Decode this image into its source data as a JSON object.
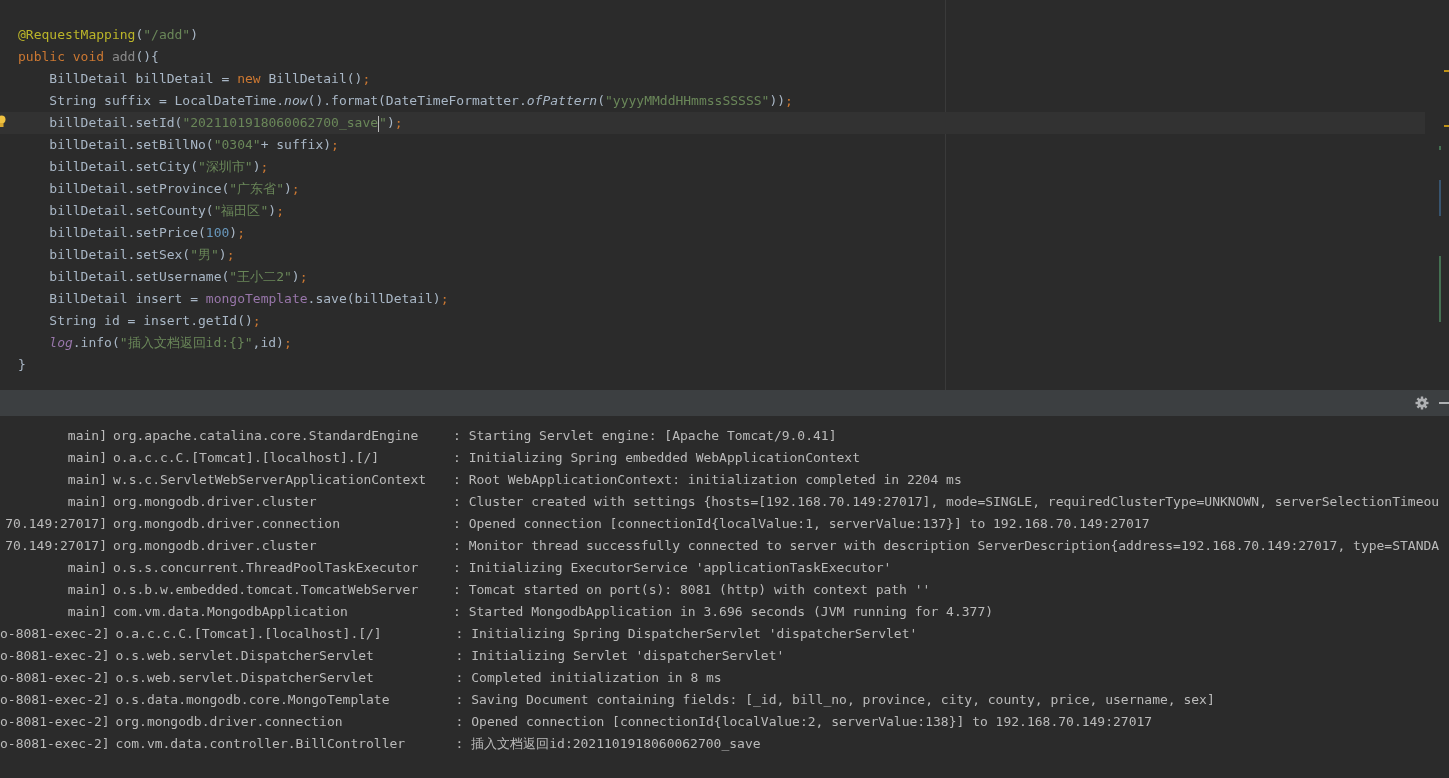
{
  "editor": {
    "lines": [
      {
        "current": false,
        "bulb": false,
        "tokens": [
          {
            "kind": "annotation",
            "text": "@RequestMapping"
          },
          {
            "kind": "plain",
            "text": "("
          },
          {
            "kind": "string",
            "text": "\"/add\""
          },
          {
            "kind": "plain",
            "text": ")"
          }
        ]
      },
      {
        "current": false,
        "bulb": false,
        "tokens": [
          {
            "kind": "keyword",
            "text": "public void "
          },
          {
            "kind": "unused",
            "text": "add"
          },
          {
            "kind": "plain",
            "text": "(){"
          }
        ]
      },
      {
        "current": false,
        "bulb": false,
        "tokens": [
          {
            "kind": "plain",
            "text": "    BillDetail billDetail = "
          },
          {
            "kind": "keyword",
            "text": "new "
          },
          {
            "kind": "plain",
            "text": "BillDetail()"
          },
          {
            "kind": "keyword",
            "text": ";"
          }
        ]
      },
      {
        "current": false,
        "bulb": false,
        "tokens": [
          {
            "kind": "plain",
            "text": "    String suffix = LocalDateTime."
          },
          {
            "kind": "italic",
            "text": "now"
          },
          {
            "kind": "plain",
            "text": "().format(DateTimeFormatter."
          },
          {
            "kind": "italic",
            "text": "ofPattern"
          },
          {
            "kind": "plain",
            "text": "("
          },
          {
            "kind": "string",
            "text": "\"yyyyMMddHHmmssSSSSS\""
          },
          {
            "kind": "plain",
            "text": "))"
          },
          {
            "kind": "keyword",
            "text": ";"
          }
        ]
      },
      {
        "current": true,
        "bulb": true,
        "tokens": [
          {
            "kind": "plain",
            "text": "    billDetail.setId("
          },
          {
            "kind": "string",
            "text": "\"2021101918060062700_save",
            "caret": true
          },
          {
            "kind": "string",
            "text": "\""
          },
          {
            "kind": "plain",
            "text": ")"
          },
          {
            "kind": "keyword",
            "text": ";"
          }
        ]
      },
      {
        "current": false,
        "bulb": false,
        "tokens": [
          {
            "kind": "plain",
            "text": "    billDetail.setBillNo("
          },
          {
            "kind": "string",
            "text": "\"0304\""
          },
          {
            "kind": "plain",
            "text": "+ suffix)"
          },
          {
            "kind": "keyword",
            "text": ";"
          }
        ]
      },
      {
        "current": false,
        "bulb": false,
        "tokens": [
          {
            "kind": "plain",
            "text": "    billDetail.setCity("
          },
          {
            "kind": "string",
            "text": "\"深圳市\""
          },
          {
            "kind": "plain",
            "text": ")"
          },
          {
            "kind": "keyword",
            "text": ";"
          }
        ]
      },
      {
        "current": false,
        "bulb": false,
        "tokens": [
          {
            "kind": "plain",
            "text": "    billDetail.setProvince("
          },
          {
            "kind": "string",
            "text": "\"广东省\""
          },
          {
            "kind": "plain",
            "text": ")"
          },
          {
            "kind": "keyword",
            "text": ";"
          }
        ]
      },
      {
        "current": false,
        "bulb": false,
        "tokens": [
          {
            "kind": "plain",
            "text": "    billDetail.setCounty("
          },
          {
            "kind": "string",
            "text": "\"福田区\""
          },
          {
            "kind": "plain",
            "text": ")"
          },
          {
            "kind": "keyword",
            "text": ";"
          }
        ]
      },
      {
        "current": false,
        "bulb": false,
        "tokens": [
          {
            "kind": "plain",
            "text": "    billDetail.setPrice("
          },
          {
            "kind": "number",
            "text": "100"
          },
          {
            "kind": "plain",
            "text": ")"
          },
          {
            "kind": "keyword",
            "text": ";"
          }
        ]
      },
      {
        "current": false,
        "bulb": false,
        "tokens": [
          {
            "kind": "plain",
            "text": "    billDetail.setSex("
          },
          {
            "kind": "string",
            "text": "\"男\""
          },
          {
            "kind": "plain",
            "text": ")"
          },
          {
            "kind": "keyword",
            "text": ";"
          }
        ]
      },
      {
        "current": false,
        "bulb": false,
        "tokens": [
          {
            "kind": "plain",
            "text": "    billDetail.setUsername("
          },
          {
            "kind": "string",
            "text": "\"王小二2\""
          },
          {
            "kind": "plain",
            "text": ")"
          },
          {
            "kind": "keyword",
            "text": ";"
          }
        ]
      },
      {
        "current": false,
        "bulb": false,
        "tokens": [
          {
            "kind": "plain",
            "text": "    BillDetail insert = "
          },
          {
            "kind": "field",
            "text": "mongoTemplate"
          },
          {
            "kind": "plain",
            "text": ".save(billDetail)"
          },
          {
            "kind": "keyword",
            "text": ";"
          }
        ]
      },
      {
        "current": false,
        "bulb": false,
        "tokens": [
          {
            "kind": "plain",
            "text": "    String id = insert.getId()"
          },
          {
            "kind": "keyword",
            "text": ";"
          }
        ]
      },
      {
        "current": false,
        "bulb": false,
        "tokens": [
          {
            "kind": "italic_field",
            "text": "    log"
          },
          {
            "kind": "plain",
            "text": ".info("
          },
          {
            "kind": "string",
            "text": "\"插入文档返回id:{}\""
          },
          {
            "kind": "plain",
            "text": ",id)"
          },
          {
            "kind": "keyword",
            "text": ";"
          }
        ]
      },
      {
        "current": false,
        "bulb": false,
        "tokens": [
          {
            "kind": "plain",
            "text": "}"
          }
        ]
      }
    ]
  },
  "console": {
    "rows": [
      {
        "thread": "main]",
        "logger": "org.apache.catalina.core.StandardEngine",
        "message": ": Starting Servlet engine: [Apache Tomcat/9.0.41]"
      },
      {
        "thread": "main]",
        "logger": "o.a.c.c.C.[Tomcat].[localhost].[/]",
        "message": ": Initializing Spring embedded WebApplicationContext"
      },
      {
        "thread": "main]",
        "logger": "w.s.c.ServletWebServerApplicationContext",
        "message": ": Root WebApplicationContext: initialization completed in 2204 ms"
      },
      {
        "thread": "main]",
        "logger": "org.mongodb.driver.cluster",
        "message": ": Cluster created with settings {hosts=[192.168.70.149:27017], mode=SINGLE, requiredClusterType=UNKNOWN, serverSelectionTimeou"
      },
      {
        "thread": "70.149:27017]",
        "logger": "org.mongodb.driver.connection",
        "message": ": Opened connection [connectionId{localValue:1, serverValue:137}] to 192.168.70.149:27017"
      },
      {
        "thread": "70.149:27017]",
        "logger": "org.mongodb.driver.cluster",
        "message": ": Monitor thread successfully connected to server with description ServerDescription{address=192.168.70.149:27017, type=STANDA"
      },
      {
        "thread": "main]",
        "logger": "o.s.s.concurrent.ThreadPoolTaskExecutor",
        "message": ": Initializing ExecutorService 'applicationTaskExecutor'"
      },
      {
        "thread": "main]",
        "logger": "o.s.b.w.embedded.tomcat.TomcatWebServer",
        "message": ": Tomcat started on port(s): 8081 (http) with context path ''"
      },
      {
        "thread": "main]",
        "logger": "com.vm.data.MongodbApplication",
        "message": ": Started MongodbApplication in 3.696 seconds (JVM running for 4.377)"
      },
      {
        "thread": "o-8081-exec-2]",
        "logger": "o.a.c.c.C.[Tomcat].[localhost].[/]",
        "message": ": Initializing Spring DispatcherServlet 'dispatcherServlet'"
      },
      {
        "thread": "o-8081-exec-2]",
        "logger": "o.s.web.servlet.DispatcherServlet",
        "message": ": Initializing Servlet 'dispatcherServlet'"
      },
      {
        "thread": "o-8081-exec-2]",
        "logger": "o.s.web.servlet.DispatcherServlet",
        "message": ": Completed initialization in 8 ms"
      },
      {
        "thread": "o-8081-exec-2]",
        "logger": "o.s.data.mongodb.core.MongoTemplate",
        "message": ": Saving Document containing fields: [_id, bill_no, province, city, county, price, username, sex]"
      },
      {
        "thread": "o-8081-exec-2]",
        "logger": "org.mongodb.driver.connection",
        "message": ": Opened connection [connectionId{localValue:2, serverValue:138}] to 192.168.70.149:27017"
      },
      {
        "thread": "o-8081-exec-2]",
        "logger": "com.vm.data.controller.BillController",
        "message": ": 插入文档返回id:2021101918060062700_save"
      }
    ]
  }
}
